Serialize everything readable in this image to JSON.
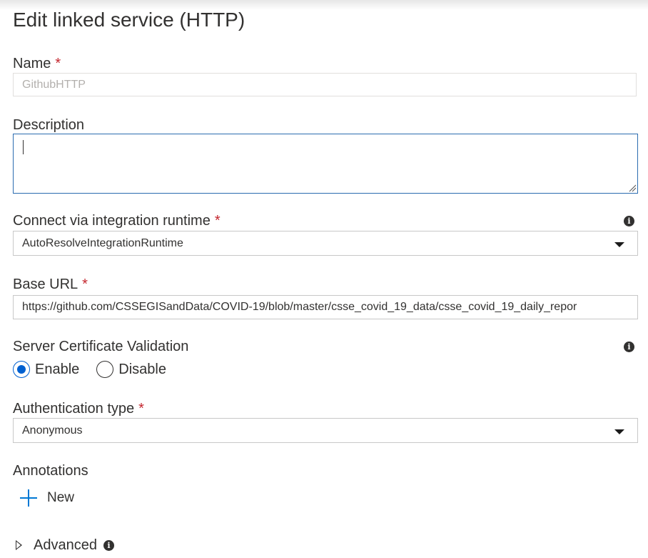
{
  "panel": {
    "title": "Edit linked service (HTTP)"
  },
  "name_field": {
    "label": "Name",
    "required_mark": "*",
    "value": "GithubHTTP"
  },
  "description_field": {
    "label": "Description",
    "value": ""
  },
  "integration_runtime": {
    "label": "Connect via integration runtime",
    "required_mark": "*",
    "selected": "AutoResolveIntegrationRuntime",
    "info_icon": "info-icon"
  },
  "base_url": {
    "label": "Base URL",
    "required_mark": "*",
    "value": "https://github.com/CSSEGISandData/COVID-19/blob/master/csse_covid_19_data/csse_covid_19_daily_repor"
  },
  "server_cert": {
    "label": "Server Certificate Validation",
    "info_icon": "info-icon",
    "options": [
      {
        "label": "Enable",
        "checked": true
      },
      {
        "label": "Disable",
        "checked": false
      }
    ]
  },
  "auth_type": {
    "label": "Authentication type",
    "required_mark": "*",
    "selected": "Anonymous"
  },
  "annotations": {
    "label": "Annotations",
    "new_label": "New"
  },
  "advanced": {
    "label": "Advanced",
    "info_icon": "info-icon"
  },
  "colors": {
    "accent": "#0078d4",
    "required": "#c4262e",
    "radio_checked": "#0060d0",
    "focus_border": "#2b6cb0"
  }
}
